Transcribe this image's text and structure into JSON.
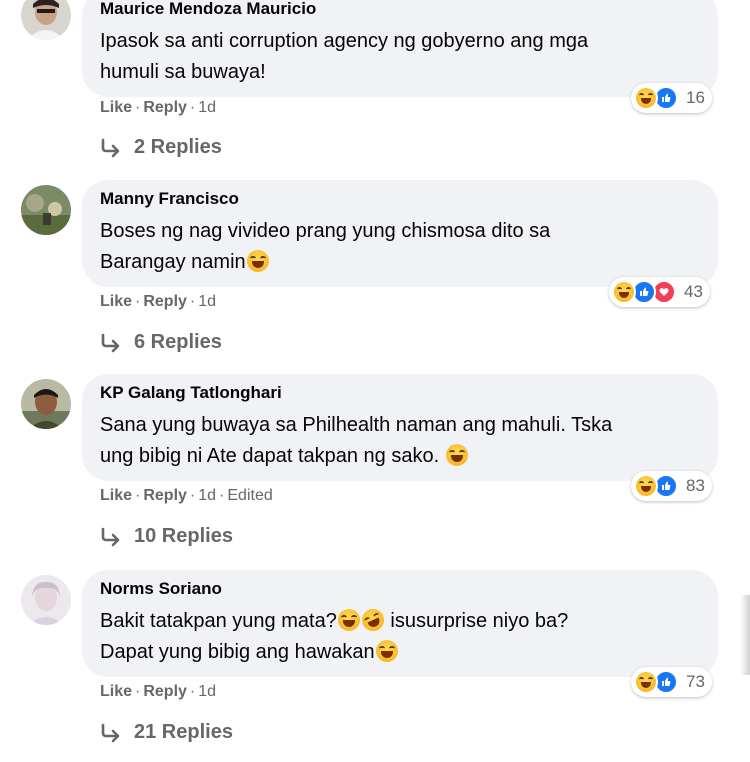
{
  "comments": [
    {
      "author": "Maurice Mendoza Mauricio",
      "line1": "Ipasok sa anti corruption agency ng gobyerno ang mga",
      "line2": "humuli sa buwaya!",
      "reaction_icons": [
        "haha-icon",
        "like-icon"
      ],
      "reaction_count": "16",
      "like_label": "Like",
      "reply_label": "Reply",
      "time": "1d",
      "edited": "",
      "replies_label": "2 Replies"
    },
    {
      "author": "Manny Francisco",
      "line1": "Boses ng nag vivideo prang yung chismosa dito sa",
      "line2": "Barangay namin",
      "reaction_icons": [
        "haha-icon",
        "like-icon",
        "love-icon"
      ],
      "reaction_count": "43",
      "like_label": "Like",
      "reply_label": "Reply",
      "time": "1d",
      "edited": "",
      "replies_label": "6 Replies"
    },
    {
      "author": "KP Galang Tatlonghari",
      "line1": "Sana yung buwaya sa Philhealth naman ang mahuli. Tska",
      "line2": "ung bibig ni Ate dapat takpan ng sako.",
      "reaction_icons": [
        "haha-icon",
        "like-icon"
      ],
      "reaction_count": "83",
      "like_label": "Like",
      "reply_label": "Reply",
      "time": "1d",
      "edited": "Edited",
      "replies_label": "10 Replies"
    },
    {
      "author": "Norms Soriano",
      "line1a": "Bakit tatakpan yung mata?",
      "line1b": "isusurprise niyo ba?",
      "line2": "Dapat yung bibig ang hawakan",
      "reaction_icons": [
        "haha-icon",
        "like-icon"
      ],
      "reaction_count": "73",
      "like_label": "Like",
      "reply_label": "Reply",
      "time": "1d",
      "edited": "",
      "replies_label": "21 Replies"
    }
  ],
  "colors": {
    "bubble": "#f0f2f5",
    "meta_text": "#65676b",
    "like_blue": "#1877f2",
    "love_red": "#f33e58",
    "haha_yellow": "#f7b928"
  }
}
